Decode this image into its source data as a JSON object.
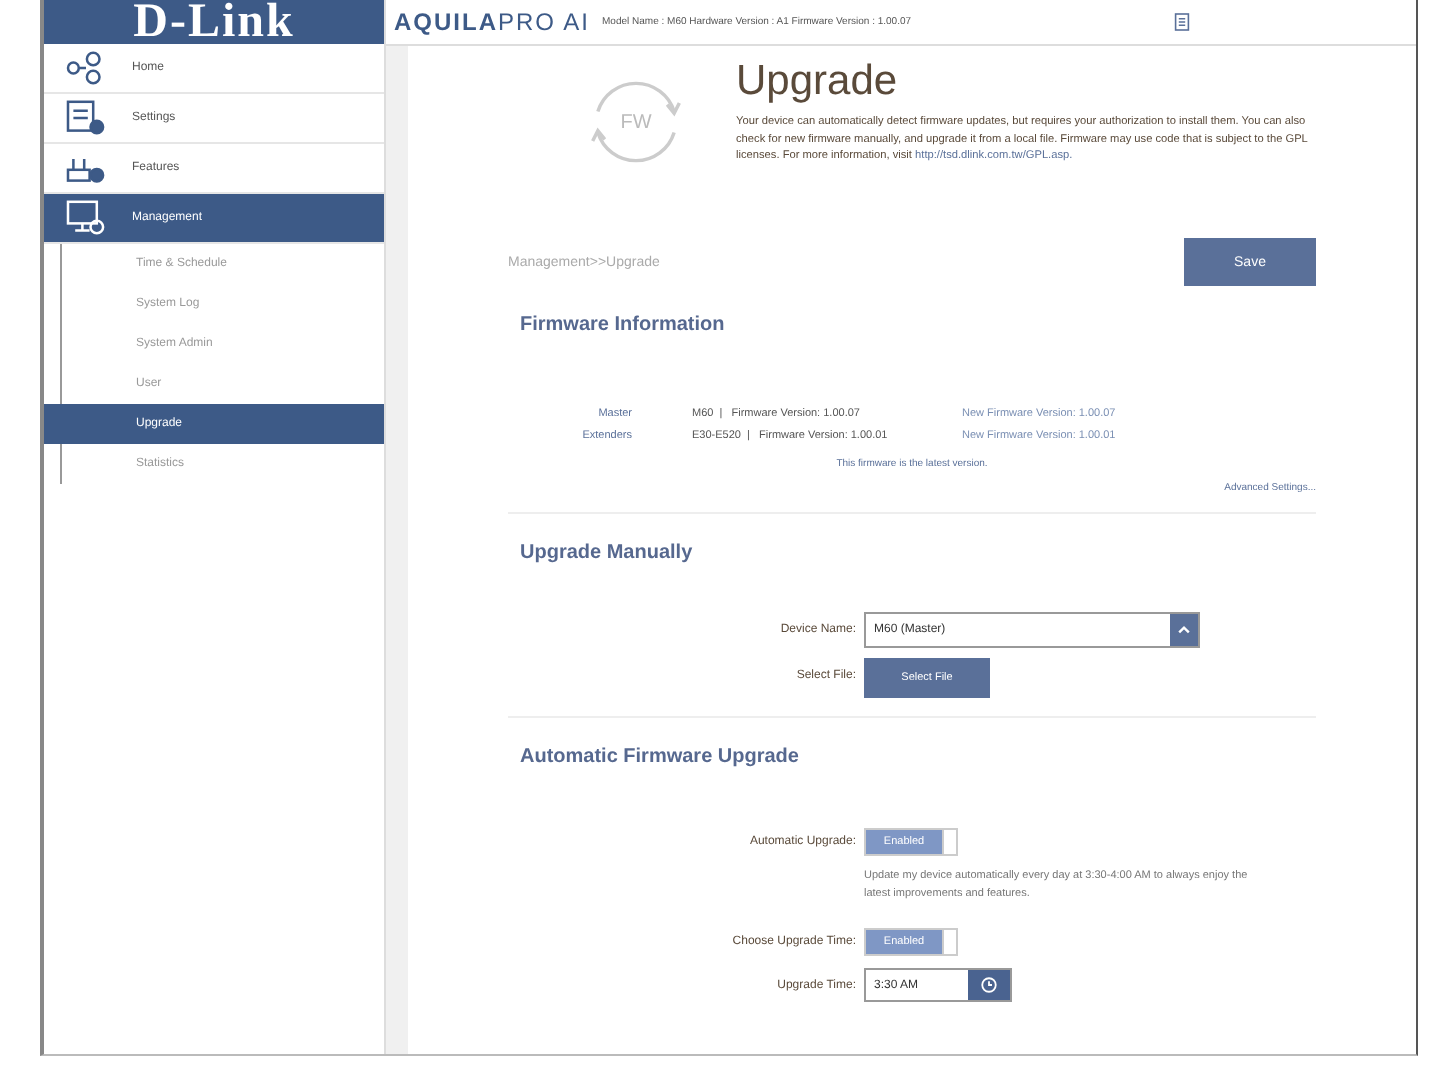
{
  "sidebar": {
    "logo": "D-Link",
    "items": [
      {
        "label": "Home",
        "selected": false
      },
      {
        "label": "Settings",
        "selected": false
      },
      {
        "label": "Features",
        "selected": false
      },
      {
        "label": "Management",
        "selected": true,
        "children": [
          {
            "label": "Time & Schedule",
            "selected": false
          },
          {
            "label": "System Log",
            "selected": false
          },
          {
            "label": "System Admin",
            "selected": false
          },
          {
            "label": "User",
            "selected": false
          },
          {
            "label": "Upgrade",
            "selected": true
          },
          {
            "label": "Statistics",
            "selected": false
          }
        ]
      }
    ]
  },
  "header": {
    "brand_bold": "AQUILA",
    "brand_light": "PRO AI",
    "device_info": "Model Name : M60 Hardware Version : A1 Firmware Version : 1.00.07"
  },
  "page": {
    "icon_label": "FW",
    "title": "Upgrade",
    "description": "Your device can automatically detect firmware updates, but requires your authorization to install them. You can also check for new firmware manually, and upgrade it from a local file. Firmware may use code that is subject to the GPL licenses. For more information, visit",
    "description_link": "http://tsd.dlink.com.tw/GPL.asp.",
    "breadcrumb": "Management>>Upgrade",
    "save": "Save"
  },
  "firmware_information": {
    "title": "Firmware Information",
    "rows": [
      {
        "role": "Master",
        "model": "M60",
        "separator": "|",
        "version": "Firmware Version: 1.00.07",
        "new_version": "New Firmware Version: 1.00.07"
      },
      {
        "role": "Extenders",
        "model": "E30-E520",
        "separator": "|",
        "version": "Firmware Version: 1.00.01",
        "new_version": "New Firmware Version: 1.00.01"
      }
    ],
    "status": "This firmware is the latest version.",
    "advanced": "Advanced Settings..."
  },
  "upgrade_manually": {
    "title": "Upgrade Manually",
    "device_label": "Device Name:",
    "device_value": "M60 (Master)",
    "file_label": "Select File:",
    "file_button": "Select File"
  },
  "automatic_upgrade": {
    "title": "Automatic Firmware Upgrade",
    "auto_label": "Automatic Upgrade:",
    "auto_toggle": {
      "label": "Enabled",
      "on": true
    },
    "auto_note": "Update my device automatically every day at 3:30-4:00 AM to always enjoy the latest improvements and features.",
    "choose_label": "Choose Upgrade Time:",
    "choose_toggle": {
      "label": "Enabled",
      "on": true
    },
    "time_label": "Upgrade Time:",
    "time_value": "3:30 AM"
  }
}
